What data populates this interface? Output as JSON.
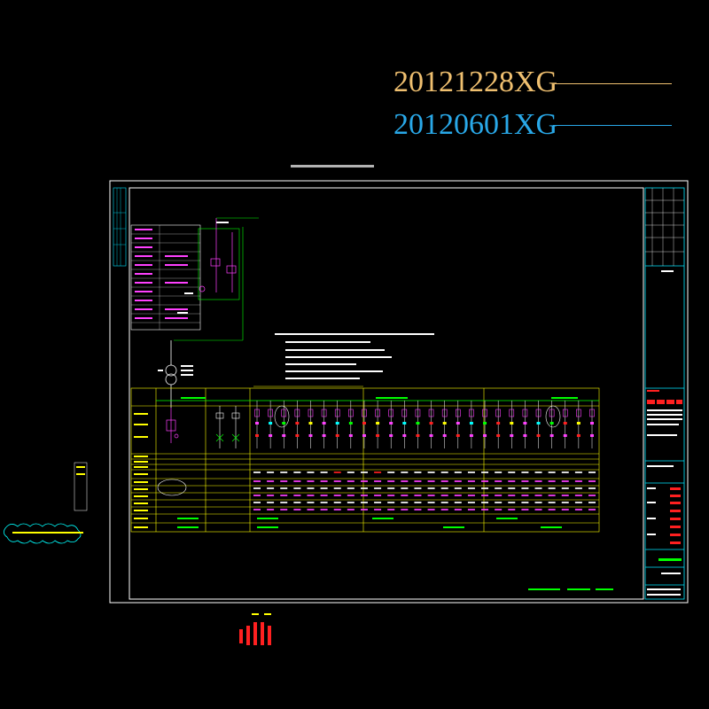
{
  "revisions": [
    {
      "label": "20121228XG",
      "color": "#f0c070"
    },
    {
      "label": "20120601XG",
      "color": "#29a8e8"
    }
  ],
  "colors": {
    "frame": "#ffffff",
    "titleblock": "#00e5ff",
    "busbar": "#ffff00",
    "circuit": "#ff40ff",
    "green": "#00ff00",
    "red": "#ff2020",
    "cyan": "#00ffff"
  },
  "icons": {
    "transformer": "transformer-icon",
    "breaker": "breaker-icon",
    "cloud": "cloud-icon"
  }
}
